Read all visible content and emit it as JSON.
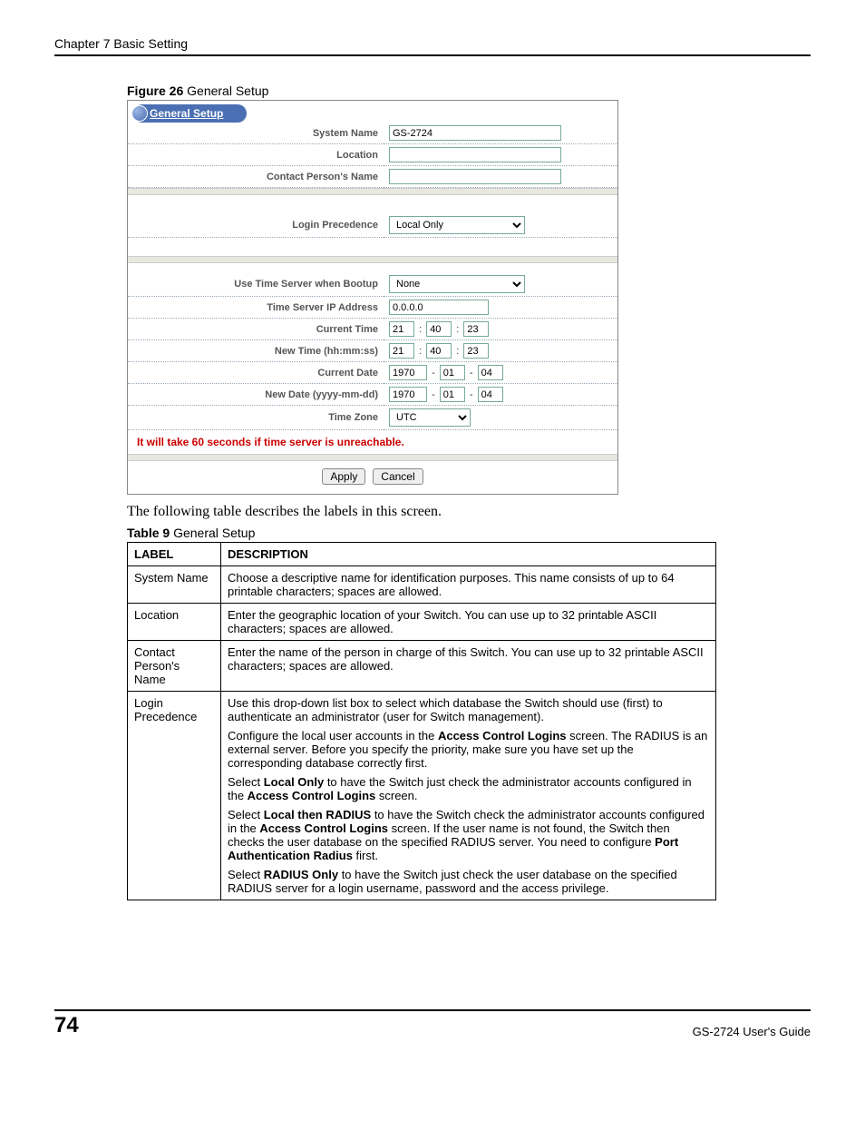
{
  "header": {
    "chapter": "Chapter 7 Basic Setting"
  },
  "figure": {
    "caption_bold": "Figure 26",
    "caption_rest": "   General Setup"
  },
  "panel": {
    "tab_title": "General Setup",
    "labels": {
      "system_name": "System Name",
      "location": "Location",
      "contact": "Contact Person's Name",
      "login_precedence": "Login Precedence",
      "use_time_server": "Use Time Server when Bootup",
      "time_server_ip": "Time Server IP Address",
      "current_time": "Current Time",
      "new_time": "New Time (hh:mm:ss)",
      "current_date": "Current Date",
      "new_date": "New Date (yyyy-mm-dd)",
      "time_zone": "Time Zone"
    },
    "values": {
      "system_name": "GS-2724",
      "location": "",
      "contact": "",
      "login_precedence": "Local Only",
      "use_time_server": "None",
      "time_server_ip": "0.0.0.0",
      "current_time_h": "21",
      "current_time_m": "40",
      "current_time_s": "23",
      "new_time_h": "21",
      "new_time_m": "40",
      "new_time_s": "23",
      "current_date_y": "1970",
      "current_date_m": "01",
      "current_date_d": "04",
      "new_date_y": "1970",
      "new_date_m": "01",
      "new_date_d": "04",
      "time_zone": "UTC"
    },
    "warning": "It will take 60 seconds if time server is unreachable.",
    "buttons": {
      "apply": "Apply",
      "cancel": "Cancel"
    }
  },
  "body_text": "The following table describes the labels in this screen.",
  "table_caption": {
    "bold": "Table 9",
    "rest": "   General Setup"
  },
  "desc_table": {
    "header_label": "LABEL",
    "header_desc": "DESCRIPTION",
    "rows": [
      {
        "label": "System Name",
        "desc_parts": [
          {
            "text": "Choose a descriptive name for identification purposes. This name consists of up to 64 printable characters; spaces are allowed."
          }
        ]
      },
      {
        "label": "Location",
        "desc_parts": [
          {
            "text": "Enter the geographic location of your Switch. You can use up to 32 printable ASCII characters; spaces are allowed."
          }
        ]
      },
      {
        "label": "Contact Person's Name",
        "desc_parts": [
          {
            "text": "Enter the name of the person in charge of this Switch. You can use up to 32 printable ASCII characters; spaces are allowed."
          }
        ]
      },
      {
        "label": "Login Precedence",
        "desc_parts": [
          {
            "text": "Use this drop-down list box to select which database the Switch should use (first) to authenticate an administrator (user for Switch management)."
          },
          {
            "prefix": "Configure the local user accounts in the ",
            "bold1": "Access Control Logins",
            "suffix": " screen. The RADIUS is an external server. Before you specify the priority, make sure you have set up the corresponding database correctly first."
          },
          {
            "prefix": "Select ",
            "bold1": "Local Only",
            "mid": " to have the Switch just check the administrator accounts configured in the ",
            "bold2": "Access Control Logins",
            "suffix": " screen."
          },
          {
            "prefix": "Select ",
            "bold1": "Local then RADIUS",
            "mid": " to have the Switch check the administrator accounts configured in the ",
            "bold2": "Access Control Logins",
            "mid2": " screen. If the user name is not found, the Switch then checks the user database on the specified RADIUS server. You need to configure ",
            "bold3": "Port Authentication Radius",
            "suffix": " first."
          },
          {
            "prefix": "Select ",
            "bold1": "RADIUS Only",
            "suffix": " to have the Switch just check the user database on the specified RADIUS server for a login username, password and the access privilege."
          }
        ]
      }
    ]
  },
  "footer": {
    "page": "74",
    "guide": "GS-2724 User's Guide"
  },
  "chart_data": {
    "type": "table",
    "title": "Table 9 General Setup",
    "columns": [
      "LABEL",
      "DESCRIPTION"
    ],
    "rows": [
      [
        "System Name",
        "Choose a descriptive name for identification purposes. This name consists of up to 64 printable characters; spaces are allowed."
      ],
      [
        "Location",
        "Enter the geographic location of your Switch. You can use up to 32 printable ASCII characters; spaces are allowed."
      ],
      [
        "Contact Person's Name",
        "Enter the name of the person in charge of this Switch. You can use up to 32 printable ASCII characters; spaces are allowed."
      ],
      [
        "Login Precedence",
        "Use this drop-down list box to select which database the Switch should use (first) to authenticate an administrator (user for Switch management). Configure the local user accounts in the Access Control Logins screen. The RADIUS is an external server. Before you specify the priority, make sure you have set up the corresponding database correctly first. Select Local Only to have the Switch just check the administrator accounts configured in the Access Control Logins screen. Select Local then RADIUS to have the Switch check the administrator accounts configured in the Access Control Logins screen. If the user name is not found, the Switch then checks the user database on the specified RADIUS server. You need to configure Port Authentication Radius first. Select RADIUS Only to have the Switch just check the user database on the specified RADIUS server for a login username, password and the access privilege."
      ]
    ]
  }
}
